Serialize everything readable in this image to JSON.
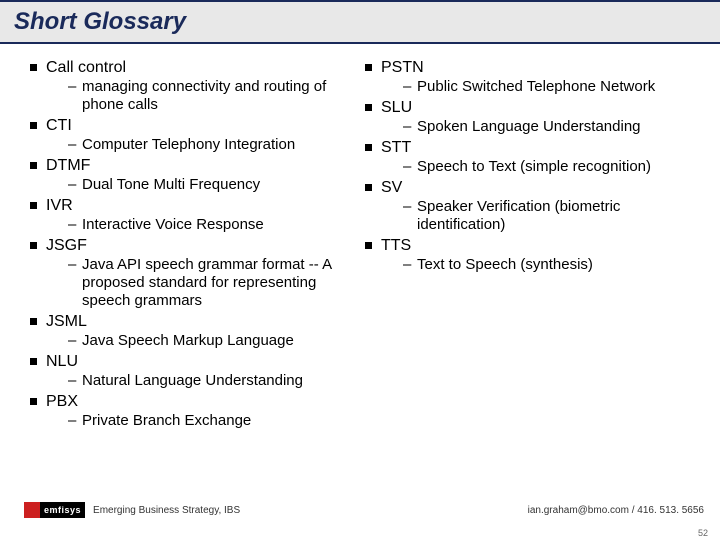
{
  "title": "Short Glossary",
  "left": [
    {
      "term": "Call control",
      "def": "managing connectivity and routing of phone calls"
    },
    {
      "term": "CTI",
      "def": "Computer Telephony Integration"
    },
    {
      "term": "DTMF",
      "def": "Dual Tone Multi Frequency"
    },
    {
      "term": "IVR",
      "def": "Interactive Voice Response"
    },
    {
      "term": "JSGF",
      "def": "Java API speech grammar format -- A proposed standard for representing speech grammars"
    },
    {
      "term": "JSML",
      "def": "Java Speech Markup Language"
    },
    {
      "term": "NLU",
      "def": "Natural Language Understanding"
    },
    {
      "term": "PBX",
      "def": "Private Branch Exchange"
    }
  ],
  "right": [
    {
      "term": "PSTN",
      "def": "Public Switched Telephone Network"
    },
    {
      "term": "SLU",
      "def": "Spoken Language Understanding"
    },
    {
      "term": "STT",
      "def": "Speech to Text (simple recognition)"
    },
    {
      "term": "SV",
      "def": "Speaker Verification (biometric identification)"
    },
    {
      "term": "TTS",
      "def": "Text to Speech (synthesis)"
    }
  ],
  "footer": {
    "logo": "emfisys",
    "left": "Emerging Business Strategy, IBS",
    "right": "ian.graham@bmo.com / 416. 513. 5656",
    "page": "52"
  }
}
